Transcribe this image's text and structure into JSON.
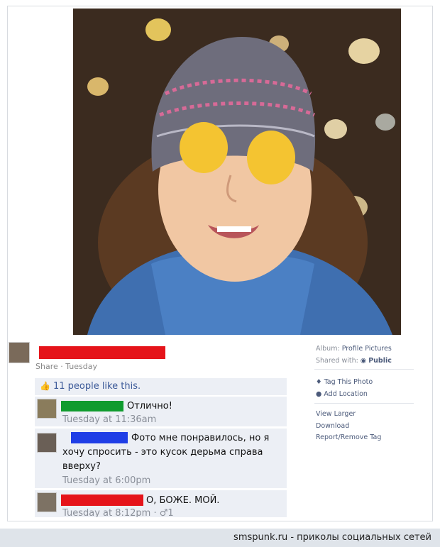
{
  "post": {
    "share_line": "Share · Tuesday",
    "likes": "11 people like this."
  },
  "comments": [
    {
      "text": "Отлично!",
      "time": "Tuesday at 11:36am"
    },
    {
      "text_line1": "Фото мне понравилось, но я",
      "text_line2": "хочу спросить - это кусок дерьма справа",
      "text_line3": "вверху?",
      "time": "Tuesday at 6:00pm"
    },
    {
      "text": "О, БОЖЕ. МОЙ.",
      "time": "Tuesday at 8:12pm · ♂1"
    }
  ],
  "sidebar": {
    "album_label": "Album:",
    "album_value": "Profile Pictures",
    "shared_label": "Shared with:",
    "shared_value": "Public",
    "tag_photo": "Tag This Photo",
    "add_location": "Add Location",
    "view_larger": "View Larger",
    "download": "Download",
    "report": "Report/Remove Tag"
  },
  "footer": {
    "caption": "smspunk.ru - приколы социальных сетей"
  },
  "colors": {
    "redact_red": "#e5141a",
    "redact_green": "#0f9b2e",
    "redact_blue": "#1f3ee6",
    "comment_bg": "#eceff5"
  }
}
